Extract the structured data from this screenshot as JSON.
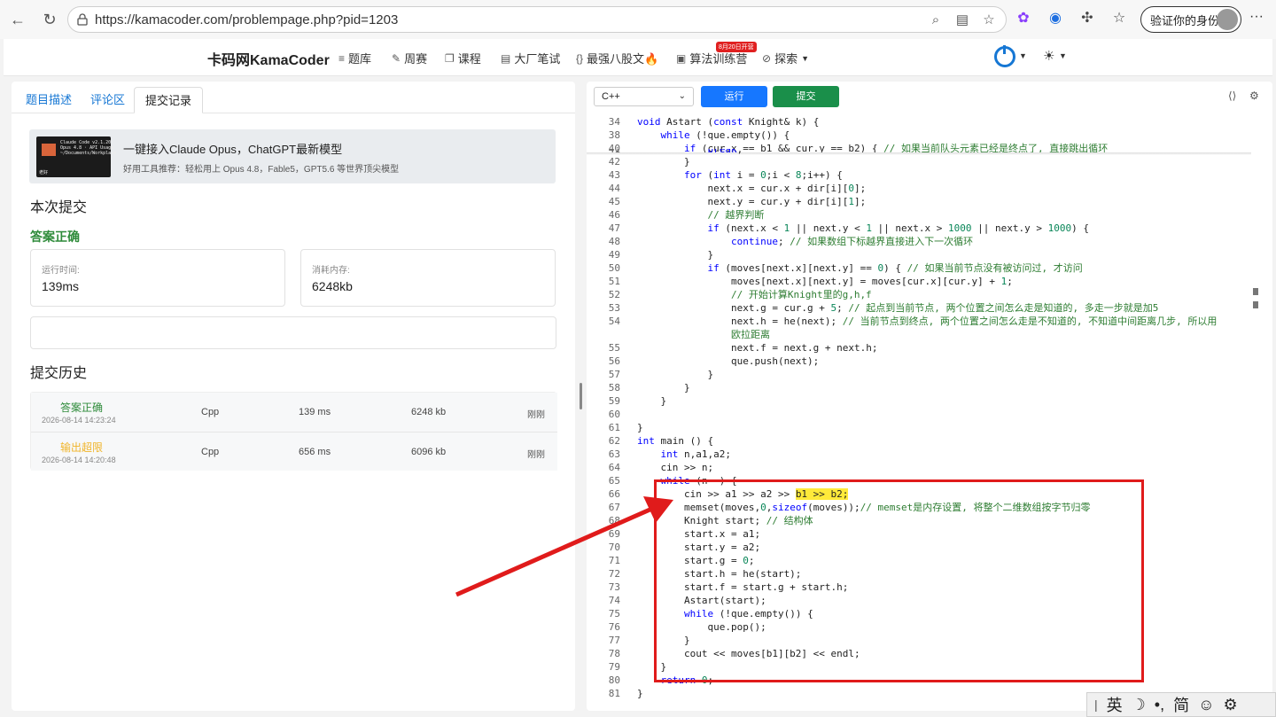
{
  "browser": {
    "url": "https://kamacoder.com/problempage.php?pid=1203",
    "profile_label": "验证你的身份"
  },
  "site": {
    "brand": "卡码网KamaCoder",
    "nav": [
      "题库",
      "周赛",
      "课程",
      "大厂笔试",
      "最强八股文🔥",
      "算法训练营",
      "探索"
    ],
    "badge": "8月20日开营"
  },
  "left": {
    "tabs": [
      "题目描述",
      "评论区",
      "提交记录"
    ],
    "ad": {
      "title": "一键接入Claude Opus，ChatGPT最新模型",
      "subtitle": "好用工具推荐：轻松用上 Opus 4.8，Fable5，GPT5.6 等世界顶尖模型",
      "thumb_text": "Claude Code v2.1.20\nOpus 4.8 · API Usage\n~/Documents/Workplace",
      "thumb_label": "老好"
    },
    "this_submit": "本次提交",
    "result": "答案正确",
    "runtime_label": "运行时间:",
    "runtime_value": "139ms",
    "memory_label": "消耗内存:",
    "memory_value": "6248kb",
    "history_title": "提交历史",
    "history": [
      {
        "status": "答案正确",
        "color": "#2e8b3a",
        "time": "2026-08-14 14:23:24",
        "lang": "Cpp",
        "ms": "139 ms",
        "kb": "6248 kb",
        "when": "刚刚"
      },
      {
        "status": "输出超限",
        "color": "#f0b429",
        "time": "2026-08-14 14:20:48",
        "lang": "Cpp",
        "ms": "656 ms",
        "kb": "6096 kb",
        "when": "刚刚"
      }
    ]
  },
  "editor": {
    "language": "C++",
    "run_label": "运行",
    "submit_label": "提交"
  },
  "ime": [
    "英",
    "☽",
    "•,",
    "简",
    "☺",
    "⚙"
  ]
}
